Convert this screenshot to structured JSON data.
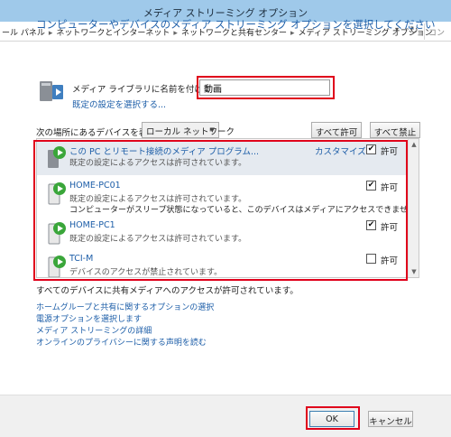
{
  "window": {
    "title": "メディア ストリーミング オプション"
  },
  "address": {
    "crumbs": [
      "ール パネル",
      "ネットワークとインターネット",
      "ネットワークと共有センター",
      "メディア ストリーミング オプション"
    ],
    "refresh_glyph": "↻",
    "search_placeholder": "コン"
  },
  "main": {
    "heading": "コンピューターやデバイスのメディア ストリーミング オプションを選択してください",
    "library_label": "メディア ライブラリに名前を付けてください:",
    "library_value": "動画",
    "default_settings_link": "既定の設定を選択する...",
    "show_devices_label": "次の場所にあるデバイスを表示:",
    "location_select": "ローカル ネットワーク",
    "allow_all_label": "すべて許可",
    "block_all_label": "すべて禁止"
  },
  "devices": [
    {
      "name": "この PC とリモート接続のメディア プログラム...",
      "desc": "既定の設定によるアクセスは許可されています。",
      "warning": "",
      "customize": "カスタマイズ...",
      "checked": "✔",
      "allow_label": "許可"
    },
    {
      "name": "HOME-PC01",
      "desc": "既定の設定によるアクセスは許可されています。",
      "warning": "コンピューターがスリープ状態になっていると、このデバイスはメディアにアクセスできません。",
      "customize": "",
      "checked": "✔",
      "allow_label": "許可"
    },
    {
      "name": "HOME-PC1",
      "desc": "既定の設定によるアクセスは許可されています。",
      "warning": "",
      "customize": "",
      "checked": "✔",
      "allow_label": "許可"
    },
    {
      "name": "TCI-M",
      "desc": "デバイスのアクセスが禁止されています。",
      "warning": "",
      "customize": "",
      "checked": "",
      "allow_label": "許可"
    }
  ],
  "status_text": "すべてのデバイスに共有メディアへのアクセスが許可されています。",
  "links": [
    "ホームグループと共有に関するオプションの選択",
    "電源オプションを選択します",
    "メディア ストリーミングの詳細",
    "オンラインのプライバシーに関する声明を読む"
  ],
  "footer": {
    "ok_label": "OK",
    "cancel_label": "キャンセル"
  },
  "colors": {
    "link": "#1d5ea8",
    "titlebar": "#9fc9ea",
    "highlight_box": "#e0001b",
    "selected_row": "#e5eaf0"
  }
}
